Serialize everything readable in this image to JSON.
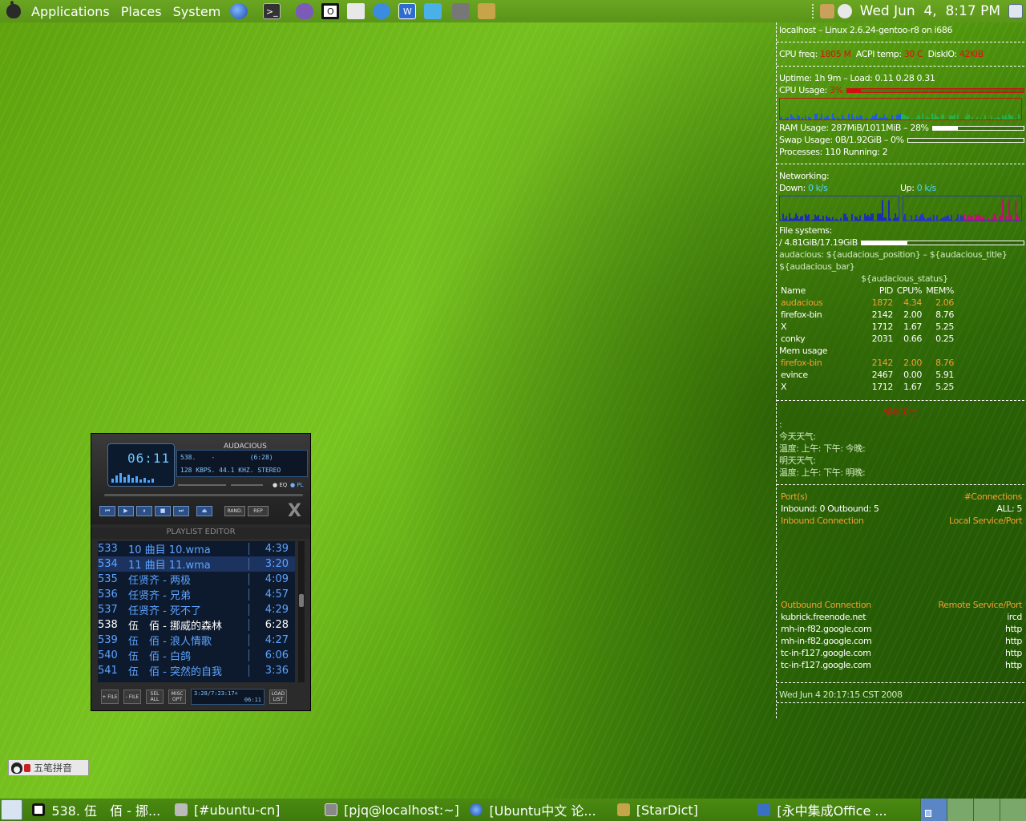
{
  "top_panel": {
    "menus": [
      "Applications",
      "Places",
      "System"
    ],
    "launchers": [
      "globe-icon",
      "terminal-icon",
      "pidgin-icon",
      "audacious-icon",
      "network-icon",
      "messenger-icon",
      "word-icon",
      "puzzle-icon",
      "camera-icon",
      "book-icon"
    ],
    "clock": "Wed Jun  4,  8:17 PM"
  },
  "conky": {
    "host": "localhost – Linux 2.6.24-gentoo-r8 on i686",
    "cpu_freq_label": "CPU freq:",
    "cpu_freq": "1805 M",
    "acpi_label": "ACPI temp:",
    "acpi_temp": "30 C",
    "diskio_label": "DiskIO:",
    "diskio": "42KiB",
    "uptime": "Uptime: 1h 9m – Load: 0.11 0.28 0.31",
    "cpu_usage_label": "CPU Usage:",
    "cpu_usage": "3%",
    "cpu_usage_fraction": 0.03,
    "ram_usage": "RAM Usage: 287MiB/1011MiB – 28%",
    "ram_fraction": 0.28,
    "swap_usage": "Swap Usage: 0B/1.92GiB – 0%",
    "swap_fraction": 0.0,
    "processes": "Processes: 110  Running: 2",
    "networking": "Networking:",
    "down_label": "Down:",
    "down": "0 k/s",
    "up_label": "Up:",
    "up": "0 k/s",
    "filesystems": "File systems:",
    "fs_root": "/ 4.81GiB/17.19GiB",
    "fs_fraction": 0.28,
    "aud_line1": "audacious: ${audacious_position} – ${audacious_title}",
    "aud_line2": "${audacious_bar}",
    "aud_line3": "${audacious_status}",
    "cpu_header": [
      "Name",
      "PID",
      "CPU%",
      "MEM%"
    ],
    "cpu_top": [
      [
        "audacious",
        "1872",
        "4.34",
        "2.06"
      ],
      [
        "firefox-bin",
        "2142",
        "2.00",
        "8.76"
      ],
      [
        "X",
        "1712",
        "1.67",
        "5.25"
      ],
      [
        "conky",
        "2031",
        "0.66",
        "0.25"
      ]
    ],
    "mem_label": "Mem usage",
    "mem_top": [
      [
        "firefox-bin",
        "2142",
        "2.00",
        "8.76"
      ],
      [
        "evince",
        "2467",
        "0.00",
        "5.91"
      ],
      [
        "X",
        "1712",
        "1.67",
        "5.25"
      ]
    ],
    "weather_title": "常州天气",
    "weather_colon": ":",
    "today": "今天天气:",
    "today_temp": "温度: 上午: 下午:  今晚:",
    "tomorrow": "明天天气:",
    "tomorrow_temp": "温度: 上午: 下午:  明晚:",
    "ports_label": "Port(s)",
    "connections_label": "#Connections",
    "inout": "Inbound: 0  Outbound: 5",
    "all": "ALL: 5",
    "inbound_conn": "Inbound Connection",
    "local_service": "Local Service/Port",
    "outbound_conn": "Outbound Connection",
    "remote_service": "Remote Service/Port",
    "connections": [
      [
        "kubrick.freenode.net",
        "ircd"
      ],
      [
        "mh-in-f82.google.com",
        "http"
      ],
      [
        "mh-in-f82.google.com",
        "http"
      ],
      [
        "tc-in-f127.google.com",
        "http"
      ],
      [
        "tc-in-f127.google.com",
        "http"
      ]
    ],
    "date": "Wed Jun  4 20:17:15 CST 2008"
  },
  "audacious": {
    "title": "AUDACIOUS",
    "time": "06:11",
    "track_line": "538.    -         (6:28)",
    "info_line": "128 KBPS. 44.1 KHZ. STEREO",
    "eq": "EQ",
    "pl": "PL",
    "controls": [
      "⏮",
      "▶",
      "⏸",
      "■",
      "⏭",
      "⏏"
    ],
    "rand": "RAND.",
    "rep": "REP",
    "playlist_title": "PLAYLIST EDITOR",
    "playlist": [
      {
        "num": "533",
        "name": "10 曲目 10.wma",
        "dur": "4:39"
      },
      {
        "num": "534",
        "name": "11 曲目 11.wma",
        "dur": "3:20"
      },
      {
        "num": "535",
        "name": "任贤齐 - 两极",
        "dur": "4:09"
      },
      {
        "num": "536",
        "name": "任贤齐 - 兄弟",
        "dur": "4:57"
      },
      {
        "num": "537",
        "name": "任贤齐 - 死不了",
        "dur": "4:29"
      },
      {
        "num": "538",
        "name": "伍　佰 - 挪威的森林",
        "dur": "6:28"
      },
      {
        "num": "539",
        "name": "伍　佰 - 浪人情歌",
        "dur": "4:27"
      },
      {
        "num": "540",
        "name": "伍　佰 - 白鸽",
        "dur": "6:06"
      },
      {
        "num": "541",
        "name": "伍　佰 - 突然的自我",
        "dur": "3:36"
      }
    ],
    "pl_buttons": [
      "+ FILE",
      "- FILE",
      "SEL ALL",
      "MISC OPT"
    ],
    "pl_total": "3:28/7:23:17+",
    "pl_time": "06:11",
    "load_list": "LOAD LIST"
  },
  "ime": {
    "text": "五笔拼音"
  },
  "taskbar": {
    "tasks": [
      "538. 伍　佰 - 挪...",
      "[#ubuntu-cn]",
      "[pjq@localhost:~]",
      "[Ubuntu中文 论...",
      "[StarDict]",
      "[永中集成Office ..."
    ]
  },
  "colors": {
    "accent_orange": "#f0a030",
    "accent_red": "#e01010",
    "accent_blue": "#6ab4ff",
    "panel_green": "#5b9419"
  }
}
